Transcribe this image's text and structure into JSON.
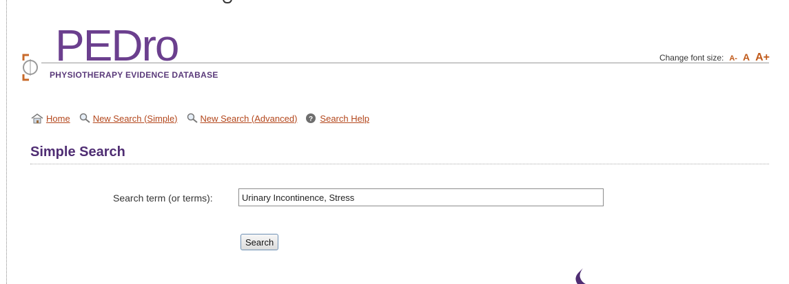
{
  "logo": {
    "main": "PEDro",
    "subtitle": "PHYSIOTHERAPY EVIDENCE DATABASE"
  },
  "font_size": {
    "label": "Change font size:",
    "small": "A-",
    "medium": "A",
    "large": "A+"
  },
  "nav": [
    {
      "label": "Home",
      "icon": "home-icon"
    },
    {
      "label": "New Search (Simple)",
      "icon": "magnifier-icon"
    },
    {
      "label": "New Search (Advanced)",
      "icon": "magnifier-icon"
    },
    {
      "label": "Search Help",
      "icon": "help-icon"
    }
  ],
  "page": {
    "title": "Simple Search"
  },
  "search": {
    "label": "Search term (or terms):",
    "value": "Urinary Incontinence, Stress",
    "button": "Search"
  },
  "colors": {
    "brand_purple": "#6b3f8e",
    "link_orange": "#b3461b",
    "title_purple": "#4f2d73"
  }
}
